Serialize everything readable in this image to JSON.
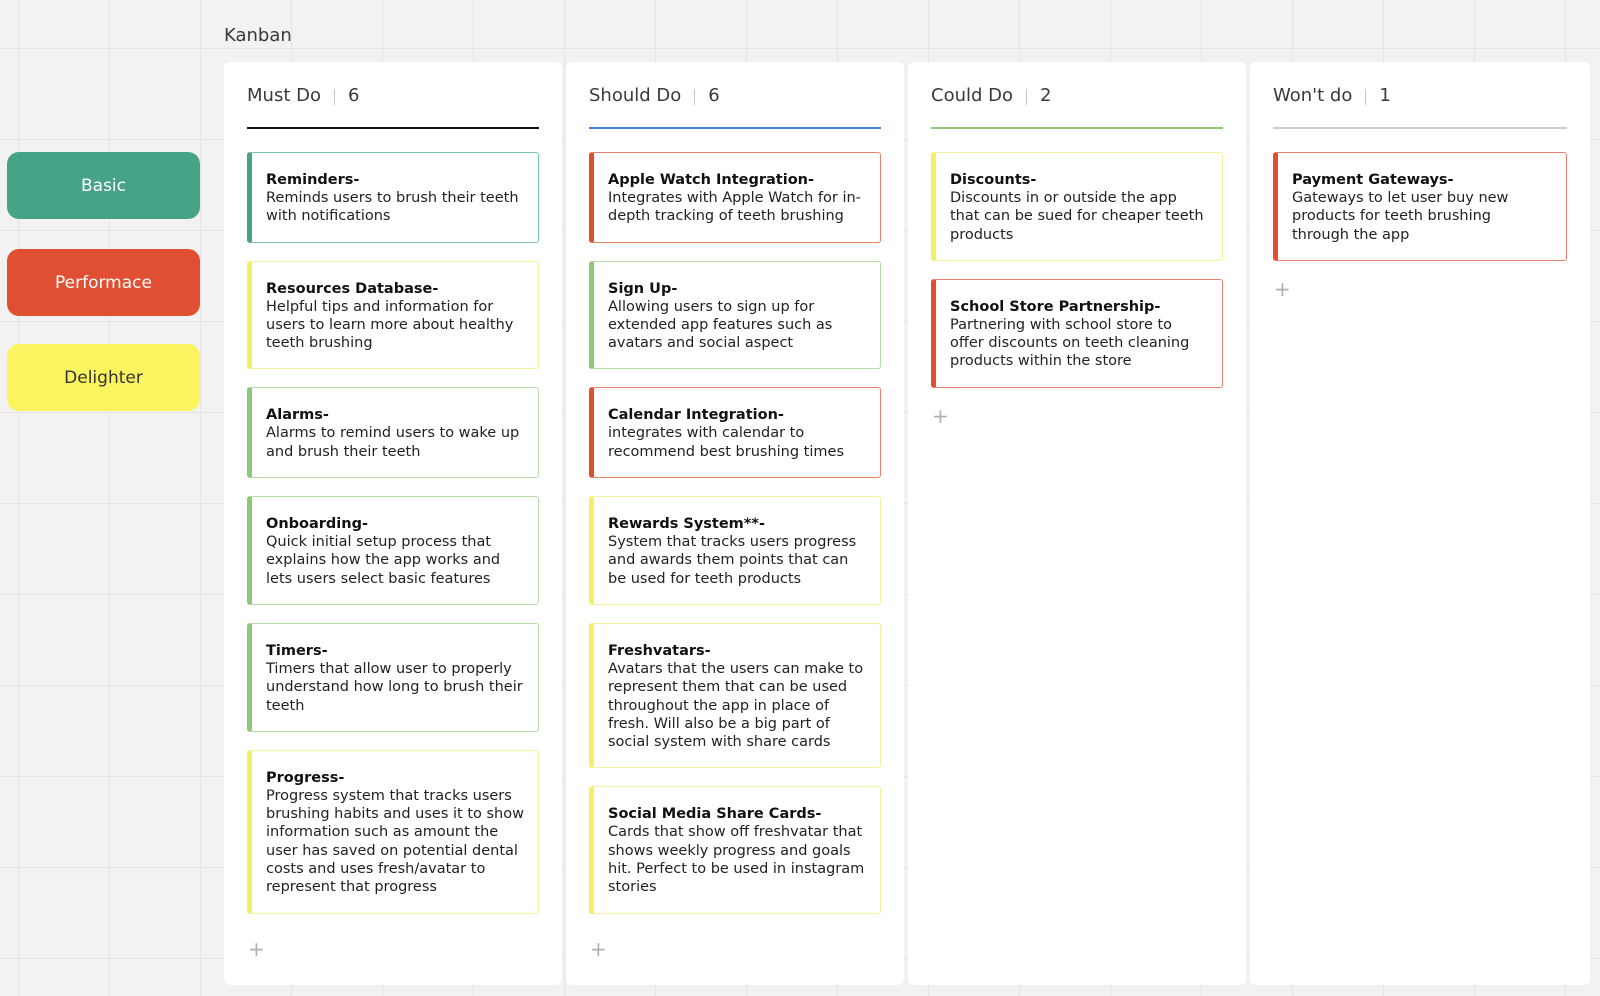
{
  "board": {
    "title": "Kanban"
  },
  "colors": {
    "basic": "#46a387",
    "performance": "#e14f32",
    "delighter": "#fcf45f",
    "must_line": "#111111",
    "should_line": "#4a7cdc",
    "could_line": "#8ec876",
    "wont_line": "#cccccc"
  },
  "legend": [
    {
      "label": "Basic",
      "color": "#46a387",
      "text_color": "#ffffff"
    },
    {
      "label": "Performace",
      "color": "#e14f32",
      "text_color": "#ffffff"
    },
    {
      "label": "Delighter",
      "color": "#fcf45f",
      "text_color": "#333333"
    }
  ],
  "columns": [
    {
      "title": "Must Do",
      "count": "6",
      "line_color": "#111111",
      "add_label": "+",
      "cards": [
        {
          "title": "Reminders-",
          "body": "Reminds users to brush their teeth with notifications",
          "accent": "#46a387",
          "border": "#7ac3ad"
        },
        {
          "title": "Resources Database-",
          "body": "Helpful tips and information for users to learn more about healthy teeth brushing",
          "accent": "#f5ef62",
          "border": "#f7f29a"
        },
        {
          "title": "Alarms-",
          "body": "Alarms to remind users to wake up and brush their teeth",
          "accent": "#8ec876",
          "border": "#b6dca5"
        },
        {
          "title": "Onboarding-",
          "body": "Quick initial setup process that explains how the app works and lets users select basic features",
          "accent": "#8ec876",
          "border": "#b6dca5"
        },
        {
          "title": "Timers-",
          "body": "Timers that allow user to properly understand how long to brush their teeth",
          "accent": "#8ec876",
          "border": "#b6dca5"
        },
        {
          "title": "Progress-",
          "body": "Progress system that tracks users brushing habits and uses it to show information such as amount the user has saved on potential dental costs and uses fresh/avatar to represent that progress",
          "accent": "#f5ef62",
          "border": "#f7f29a"
        }
      ]
    },
    {
      "title": "Should Do",
      "count": "6",
      "line_color": "#4a7cdc",
      "add_label": "+",
      "cards": [
        {
          "title": "Apple Watch Integration-",
          "body": "Integrates with Apple Watch for in-depth tracking of teeth brushing",
          "accent": "#e14f32",
          "border": "#e9816c"
        },
        {
          "title": "Sign Up-",
          "body": "Allowing users to sign up for extended app features such as avatars and social aspect",
          "accent": "#8ec876",
          "border": "#b6dca5"
        },
        {
          "title": "Calendar Integration-",
          "body": "integrates with calendar to recommend best brushing times",
          "accent": "#e14f32",
          "border": "#e9816c"
        },
        {
          "title": "Rewards System**-",
          "body": "System that tracks users progress and awards them points that can be used for teeth products",
          "accent": "#f5ef62",
          "border": "#f7f29a"
        },
        {
          "title": "Freshvatars-",
          "body": "Avatars that the users can make to represent them that can be used throughout the app in place of fresh. Will also be a big part of social system with share cards",
          "accent": "#f5ef62",
          "border": "#f7f29a"
        },
        {
          "title": "Social Media Share Cards-",
          "body": "Cards that show off freshvatar that shows weekly progress and goals hit. Perfect to be used in instagram stories",
          "accent": "#f5ef62",
          "border": "#f7f29a"
        }
      ]
    },
    {
      "title": "Could Do",
      "count": "2",
      "line_color": "#8ec876",
      "add_label": "+",
      "cards": [
        {
          "title": "Discounts-",
          "body": "Discounts in or outside the app that can be sued for cheaper teeth products",
          "accent": "#f5ef62",
          "border": "#f7f29a"
        },
        {
          "title": "School Store Partnership-",
          "body": "Partnering with school store to offer discounts on teeth cleaning products within the store",
          "accent": "#e14f32",
          "border": "#e9816c"
        }
      ]
    },
    {
      "title": "Won't do",
      "count": "1",
      "line_color": "#cccccc",
      "add_label": "+",
      "cards": [
        {
          "title": "Payment Gateways-",
          "body": "Gateways to let user buy new products for teeth brushing through the app",
          "accent": "#e14f32",
          "border": "#e9816c"
        }
      ]
    }
  ]
}
